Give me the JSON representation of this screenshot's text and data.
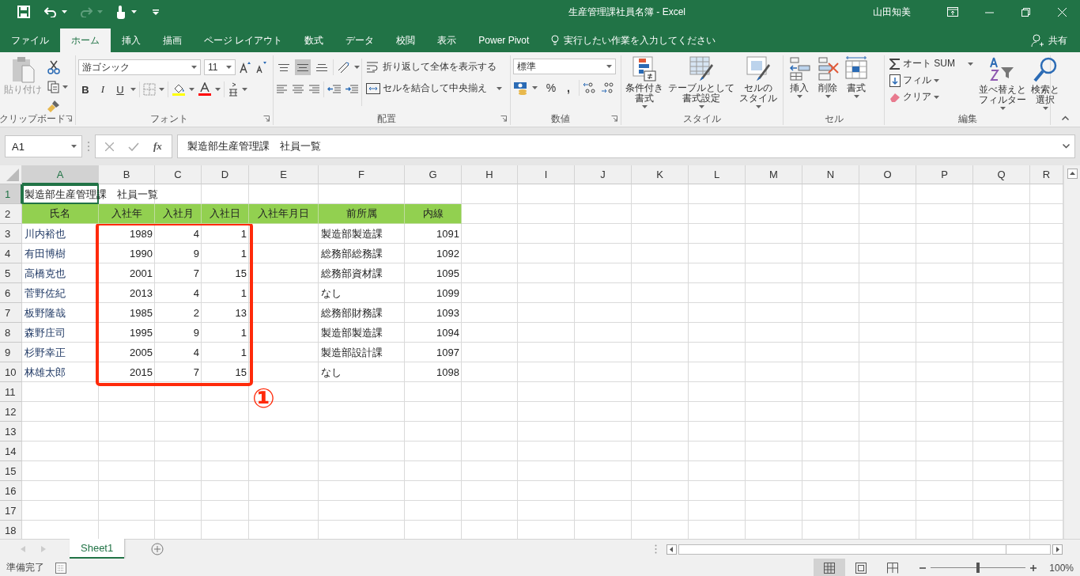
{
  "title_bar": {
    "title": "生産管理課社員名簿  -  Excel",
    "user": "山田知美"
  },
  "menu_tabs": [
    {
      "label": "ファイル",
      "selected": false
    },
    {
      "label": "ホーム",
      "selected": true
    },
    {
      "label": "挿入",
      "selected": false
    },
    {
      "label": "描画",
      "selected": false
    },
    {
      "label": "ページ レイアウト",
      "selected": false
    },
    {
      "label": "数式",
      "selected": false
    },
    {
      "label": "データ",
      "selected": false
    },
    {
      "label": "校閲",
      "selected": false
    },
    {
      "label": "表示",
      "selected": false
    },
    {
      "label": "Power Pivot",
      "selected": false
    }
  ],
  "tell_me": {
    "placeholder": "実行したい作業を入力してください"
  },
  "share": "共有",
  "ribbon": {
    "clipboard": {
      "paste": "貼り付け",
      "label": "クリップボード"
    },
    "font": {
      "font_name": "游ゴシック",
      "font_size": "11",
      "bold": "B",
      "italic": "I",
      "underline": "U",
      "label": "フォント"
    },
    "alignment": {
      "vertical_align": [
        {
          "selected": false
        },
        {
          "selected": true
        },
        {
          "selected": false
        }
      ],
      "wrap_text": "折り返して全体を表示する",
      "merge_center": "セルを結合して中央揃え",
      "label": "配置"
    },
    "number": {
      "format": "標準",
      "percent": "%",
      "comma": ",",
      "label": "数値"
    },
    "styles": {
      "buttons": [
        {
          "lines": [
            "条件付き",
            "書式"
          ]
        },
        {
          "lines": [
            "テーブルとして",
            "書式設定"
          ]
        },
        {
          "lines": [
            "セルの",
            "スタイル"
          ]
        }
      ],
      "label": "スタイル"
    },
    "cells": {
      "buttons": [
        "挿入",
        "削除",
        "書式"
      ],
      "label": "セル"
    },
    "editing": {
      "autosum": "オート SUM",
      "fill": "フィル",
      "clear": "クリア",
      "sort_filter": [
        "並べ替えと",
        "フィルター"
      ],
      "find_select": [
        "検索と",
        "選択"
      ],
      "label": "編集"
    }
  },
  "formula_bar": {
    "name_box": "A1",
    "function_label": "fx",
    "formula": "製造部生産管理課　社員一覧"
  },
  "grid": {
    "columns": [
      {
        "label": "A",
        "selected": true
      },
      {
        "label": "B",
        "selected": false
      },
      {
        "label": "C",
        "selected": false
      },
      {
        "label": "D",
        "selected": false
      },
      {
        "label": "E",
        "selected": false
      },
      {
        "label": "F",
        "selected": false
      },
      {
        "label": "G",
        "selected": false
      },
      {
        "label": "H",
        "selected": false
      },
      {
        "label": "I",
        "selected": false
      },
      {
        "label": "J",
        "selected": false
      },
      {
        "label": "K",
        "selected": false
      },
      {
        "label": "L",
        "selected": false
      },
      {
        "label": "M",
        "selected": false
      },
      {
        "label": "N",
        "selected": false
      },
      {
        "label": "O",
        "selected": false
      },
      {
        "label": "P",
        "selected": false
      },
      {
        "label": "Q",
        "selected": false
      },
      {
        "label": "R",
        "selected": false
      }
    ],
    "rows": [
      {
        "label": "1",
        "selected": true,
        "kind": "title",
        "cells": [
          "製造部生産管理課　社員一覧"
        ]
      },
      {
        "label": "2",
        "selected": false,
        "kind": "header",
        "cells": [
          "氏名",
          "入社年",
          "入社月",
          "入社日",
          "入社年月日",
          "前所属",
          "内線"
        ]
      },
      {
        "label": "3",
        "selected": false,
        "kind": "data",
        "cells": [
          "川内裕也",
          "1989",
          "4",
          "1",
          null,
          "製造部製造課",
          "1091"
        ]
      },
      {
        "label": "4",
        "selected": false,
        "kind": "data",
        "cells": [
          "有田博樹",
          "1990",
          "9",
          "1",
          null,
          "総務部総務課",
          "1092"
        ]
      },
      {
        "label": "5",
        "selected": false,
        "kind": "data",
        "cells": [
          "高橋克也",
          "2001",
          "7",
          "15",
          null,
          "総務部資材課",
          "1095"
        ]
      },
      {
        "label": "6",
        "selected": false,
        "kind": "data",
        "cells": [
          "菅野佐紀",
          "2013",
          "4",
          "1",
          null,
          "なし",
          "1099"
        ]
      },
      {
        "label": "7",
        "selected": false,
        "kind": "data",
        "cells": [
          "板野隆哉",
          "1985",
          "2",
          "13",
          null,
          "総務部財務課",
          "1093"
        ]
      },
      {
        "label": "8",
        "selected": false,
        "kind": "data",
        "cells": [
          "森野庄司",
          "1995",
          "9",
          "1",
          null,
          "製造部製造課",
          "1094"
        ]
      },
      {
        "label": "9",
        "selected": false,
        "kind": "data",
        "cells": [
          "杉野幸正",
          "2005",
          "4",
          "1",
          null,
          "製造部設計課",
          "1097"
        ]
      },
      {
        "label": "10",
        "selected": false,
        "kind": "data",
        "cells": [
          "林雄太郎",
          "2015",
          "7",
          "15",
          null,
          "なし",
          "1098"
        ]
      },
      {
        "label": "11",
        "selected": false,
        "kind": "empty",
        "cells": []
      },
      {
        "label": "12",
        "selected": false,
        "kind": "empty",
        "cells": []
      },
      {
        "label": "13",
        "selected": false,
        "kind": "empty",
        "cells": []
      },
      {
        "label": "14",
        "selected": false,
        "kind": "empty",
        "cells": []
      },
      {
        "label": "15",
        "selected": false,
        "kind": "empty",
        "cells": []
      },
      {
        "label": "16",
        "selected": false,
        "kind": "empty",
        "cells": []
      },
      {
        "label": "17",
        "selected": false,
        "kind": "empty",
        "cells": []
      },
      {
        "label": "18",
        "selected": false,
        "kind": "empty",
        "cells": []
      }
    ]
  },
  "annotation": {
    "label": "①"
  },
  "sheet_tabs": [
    {
      "label": "Sheet1",
      "selected": true
    }
  ],
  "status_bar": {
    "status": "準備完了",
    "zoom": {
      "level": 0.5,
      "reading": "100%"
    }
  }
}
